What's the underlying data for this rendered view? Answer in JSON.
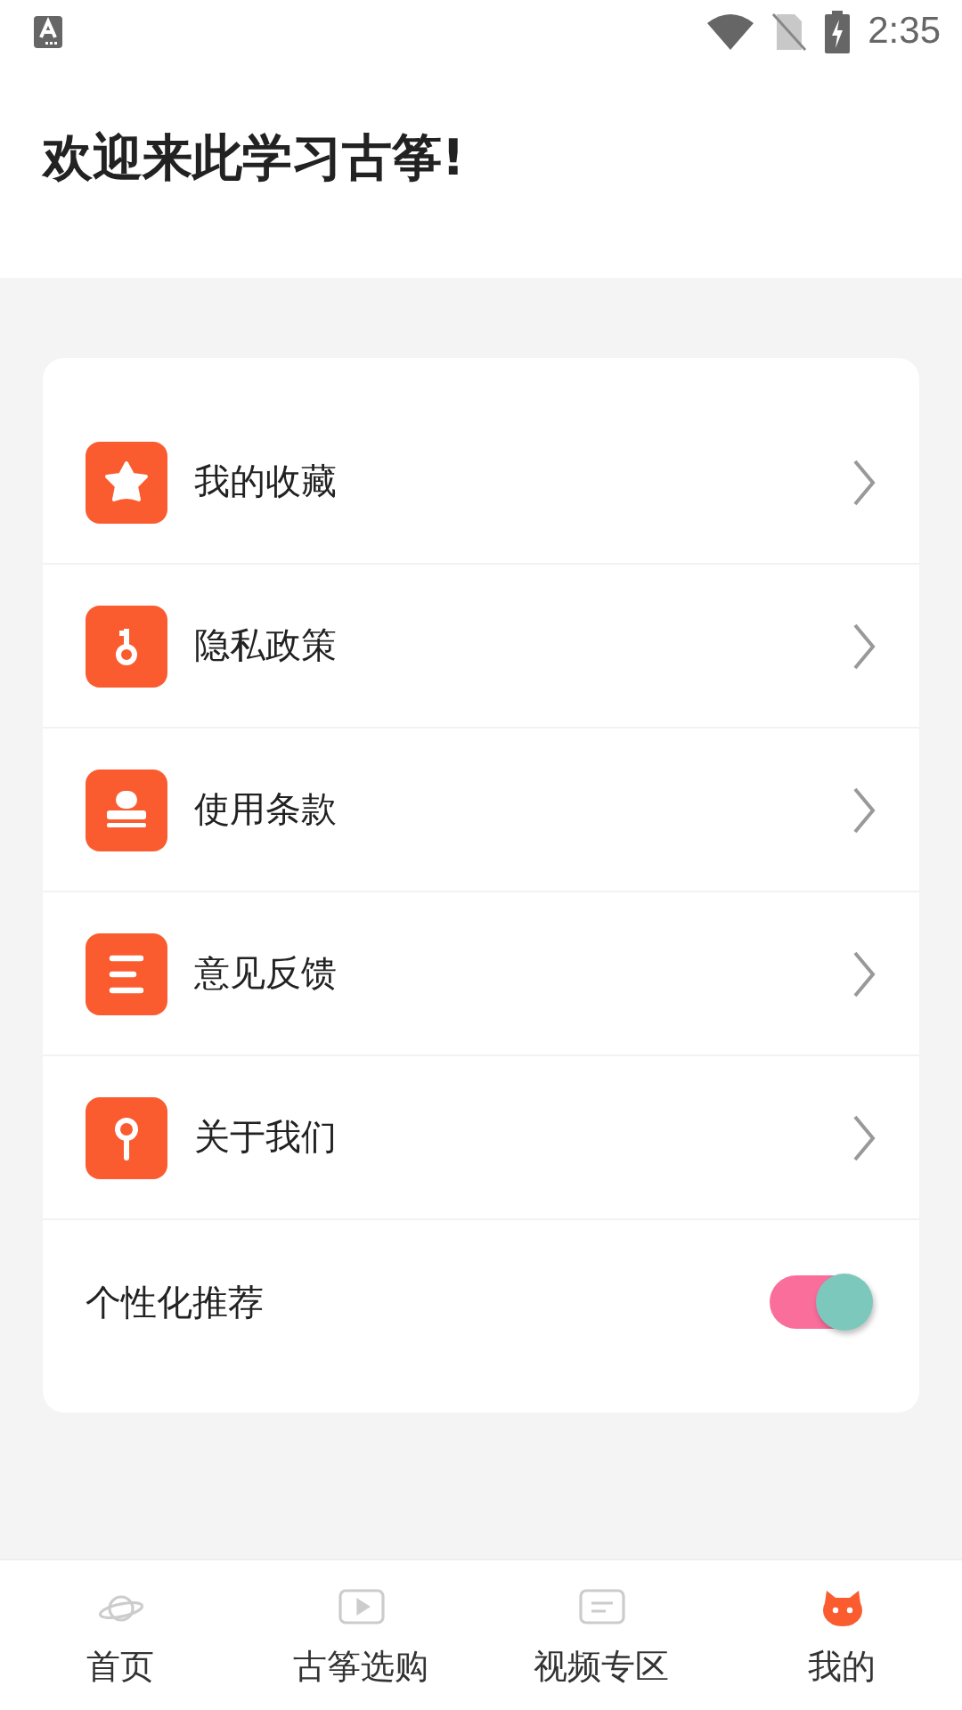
{
  "status_bar": {
    "time": "2:35"
  },
  "header": {
    "title": "欢迎来此学习古筝!"
  },
  "menu": [
    {
      "kind": "star",
      "label": "我的收藏"
    },
    {
      "kind": "key",
      "label": "隐私政策"
    },
    {
      "kind": "stamp",
      "label": "使用条款"
    },
    {
      "kind": "lines",
      "label": "意见反馈"
    },
    {
      "kind": "pin",
      "label": "关于我们"
    }
  ],
  "personalized": {
    "label": "个性化推荐",
    "on": true
  },
  "tabs": [
    {
      "kind": "planet",
      "label": "首页",
      "selected": false
    },
    {
      "kind": "play",
      "label": "古筝选购",
      "selected": false
    },
    {
      "kind": "note",
      "label": "视频专区",
      "selected": false
    },
    {
      "kind": "face",
      "label": "我的",
      "selected": true
    }
  ]
}
